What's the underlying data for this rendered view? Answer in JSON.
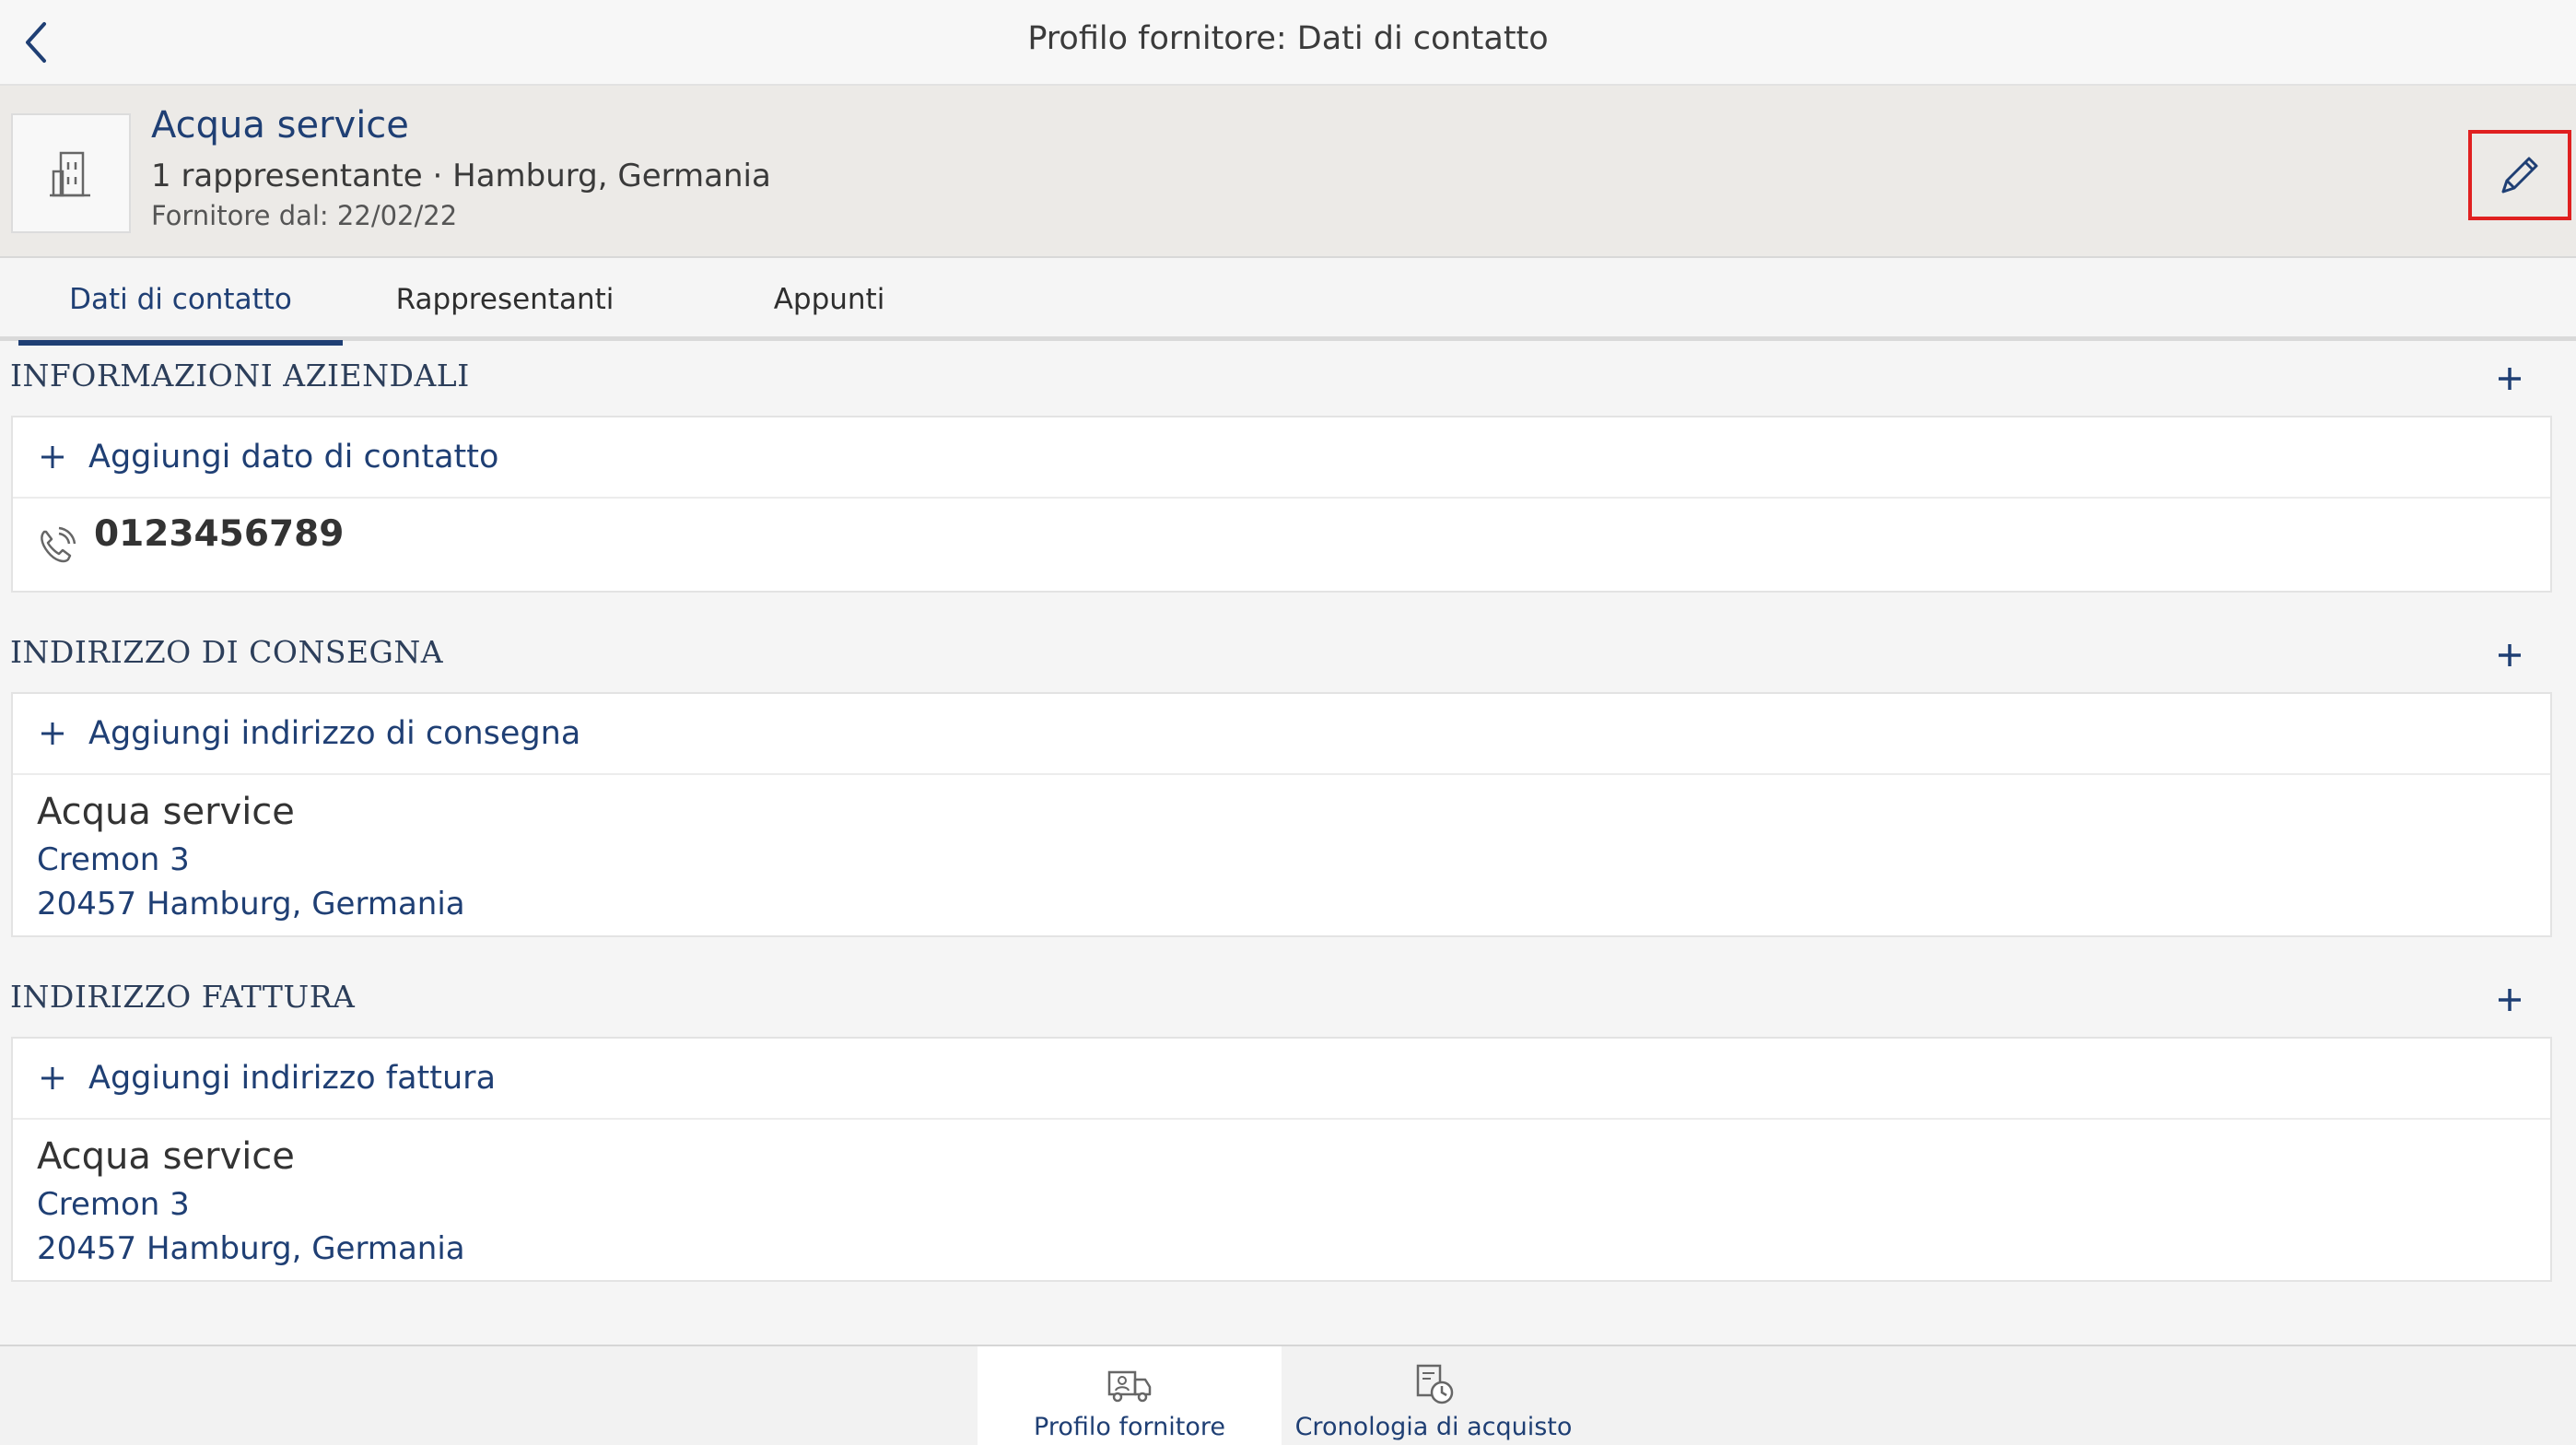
{
  "nav": {
    "title": "Profilo fornitore: Dati di contatto",
    "back_icon": "chevron-left-icon"
  },
  "supplier": {
    "name": "Acqua service",
    "subtitle": "1 rappresentante · Hamburg, Germania",
    "since": "Fornitore dal: 22/02/22",
    "avatar_icon": "building-icon",
    "edit_icon": "pencil-icon"
  },
  "tabs": [
    {
      "label": "Dati di contatto",
      "active": true
    },
    {
      "label": "Rappresentanti",
      "active": false
    },
    {
      "label": "Appunti",
      "active": false
    }
  ],
  "sections": {
    "company": {
      "title": "INFORMAZIONI AZIENDALI",
      "add_label": "Aggiungi dato di contatto",
      "phone": "0123456789"
    },
    "delivery": {
      "title": "INDIRIZZO DI CONSEGNA",
      "add_label": "Aggiungi indirizzo di consegna",
      "name": "Acqua service",
      "street": "Cremon 3",
      "city": "20457 Hamburg, Germania"
    },
    "invoice": {
      "title": "INDIRIZZO FATTURA",
      "add_label": "Aggiungi indirizzo fattura",
      "name": "Acqua service",
      "street": "Cremon 3",
      "city": "20457 Hamburg, Germania"
    }
  },
  "bottom_tabs": [
    {
      "label": "Profilo fornitore",
      "icon": "supplier-truck-icon",
      "active": true
    },
    {
      "label": "Cronologia di acquisto",
      "icon": "purchase-history-icon",
      "active": false
    }
  ],
  "colors": {
    "accent": "#1f3f74",
    "highlight": "#e02020"
  }
}
